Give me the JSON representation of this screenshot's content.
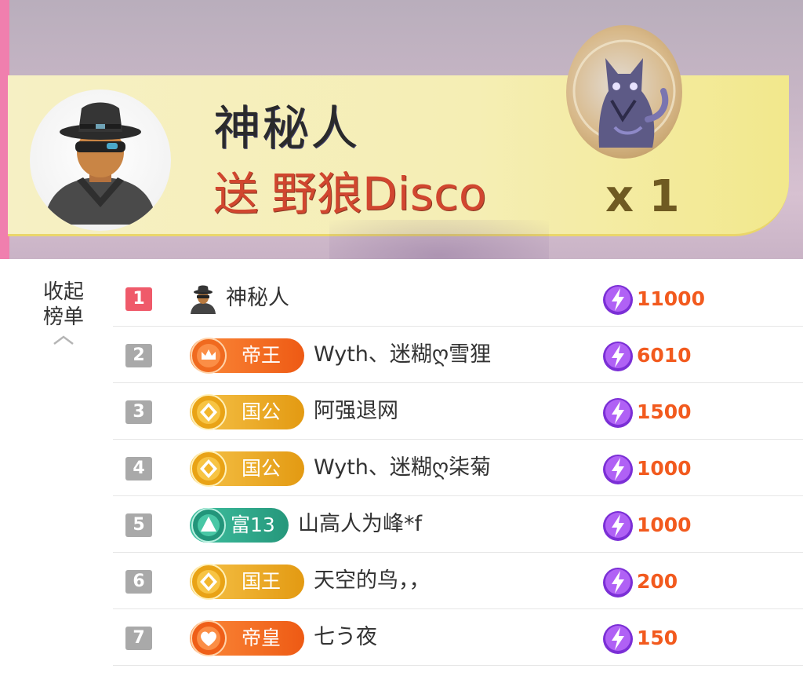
{
  "banner": {
    "sender_name": "神秘人",
    "send_verb": "送",
    "gift_name": "野狼Disco",
    "gift_count": "x 1"
  },
  "panel": {
    "collapse_label": "收起榜单"
  },
  "ranking": [
    {
      "rank": "1",
      "badge": null,
      "badge_text": "",
      "badge_style": "",
      "name": "神秘人",
      "score": "11000"
    },
    {
      "rank": "2",
      "badge": "crown-icon",
      "badge_text": "帝王",
      "badge_style": "orange",
      "name": "Wyth、迷糊ღ雪狸",
      "score": "6010"
    },
    {
      "rank": "3",
      "badge": "diamond-icon",
      "badge_text": "国公",
      "badge_style": "gold",
      "name": "阿强退网",
      "score": "1500"
    },
    {
      "rank": "4",
      "badge": "diamond-icon",
      "badge_text": "国公",
      "badge_style": "gold",
      "name": "Wyth、迷糊ღ柒菊",
      "score": "1000"
    },
    {
      "rank": "5",
      "badge": "triangle-icon",
      "badge_text": "富13",
      "badge_style": "teal",
      "name": "山高人为峰*f",
      "score": "1000"
    },
    {
      "rank": "6",
      "badge": "diamond-icon",
      "badge_text": "国王",
      "badge_style": "gold",
      "name": "天空的鸟，，",
      "score": "200"
    },
    {
      "rank": "7",
      "badge": "heart-wing-icon",
      "badge_text": "帝皇",
      "badge_style": "orange",
      "name": "七う夜",
      "score": "150"
    }
  ],
  "colors": {
    "score": "#f25a1e",
    "rank_top": "#ef5a6a",
    "rank_default": "#a9a9a9",
    "gift_text": "#d1462f"
  }
}
